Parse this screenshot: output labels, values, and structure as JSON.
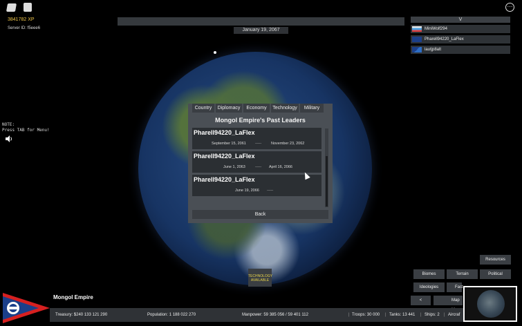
{
  "hud": {
    "xp": "3841782 XP",
    "server_id": "Server ID: f5eee6",
    "date": "January 19, 2067",
    "note_text": "NOTE:\nPress TAB for Menu!"
  },
  "playerlist": {
    "toggle": "V",
    "players": [
      {
        "name": "MiniWolf294"
      },
      {
        "name": "Pharell94220_LaFlex"
      },
      {
        "name": "lautjp8alt"
      }
    ]
  },
  "panel": {
    "tabs": [
      "Country",
      "Diplomacy",
      "Economy",
      "Technology",
      "Military"
    ],
    "title": "Mongol Empire's Past Leaders",
    "leaders": [
      {
        "name": "Pharell94220_LaFlex",
        "start": "September 15, 2061",
        "separator": "-----",
        "end": "November 23, 2062"
      },
      {
        "name": "Pharell94220_LaFlex",
        "start": "June 1, 2063",
        "separator": "-----",
        "end": "April 16, 2066"
      },
      {
        "name": "Pharell94220_LaFlex",
        "start": "June 19, 2066",
        "separator": "-----",
        "end": ""
      }
    ],
    "back_label": "Back"
  },
  "tech_button": "TECHNOLOGY AVAILABLE",
  "map_buttons": {
    "resources": "Resources",
    "biomes": "Biomes",
    "terrain": "Terrain",
    "political": "Political",
    "ideologies": "Ideologies",
    "factions": "Fact",
    "prev": "<",
    "map_mode": "Map M"
  },
  "country": {
    "name": "Mongol Empire"
  },
  "stats": {
    "treasury": "Treasury:  $240 133 121 290",
    "population": "Population: 1 188 022 270",
    "manpower": "Manpower:  59 385 056  /  59 401 112",
    "troops": "Troops: 30 000",
    "tanks": "Tanks: 13 441",
    "ships": "Ships: 2",
    "aircraft": "Aircraf"
  },
  "colors": {
    "panel_bg": "#4a4f55",
    "button_bg": "#3a3e43",
    "xp_gold": "#f2c84b",
    "tech_text": "#e6d24a",
    "flag_red": "#d62020",
    "flag_blue": "#1b3f8a"
  },
  "icons": {
    "top_left_1": "roblox-logo-icon",
    "top_left_2": "chat-icon",
    "menu": "more-options-icon",
    "sound": "speaker-icon",
    "cursor": "mouse-cursor-icon"
  }
}
